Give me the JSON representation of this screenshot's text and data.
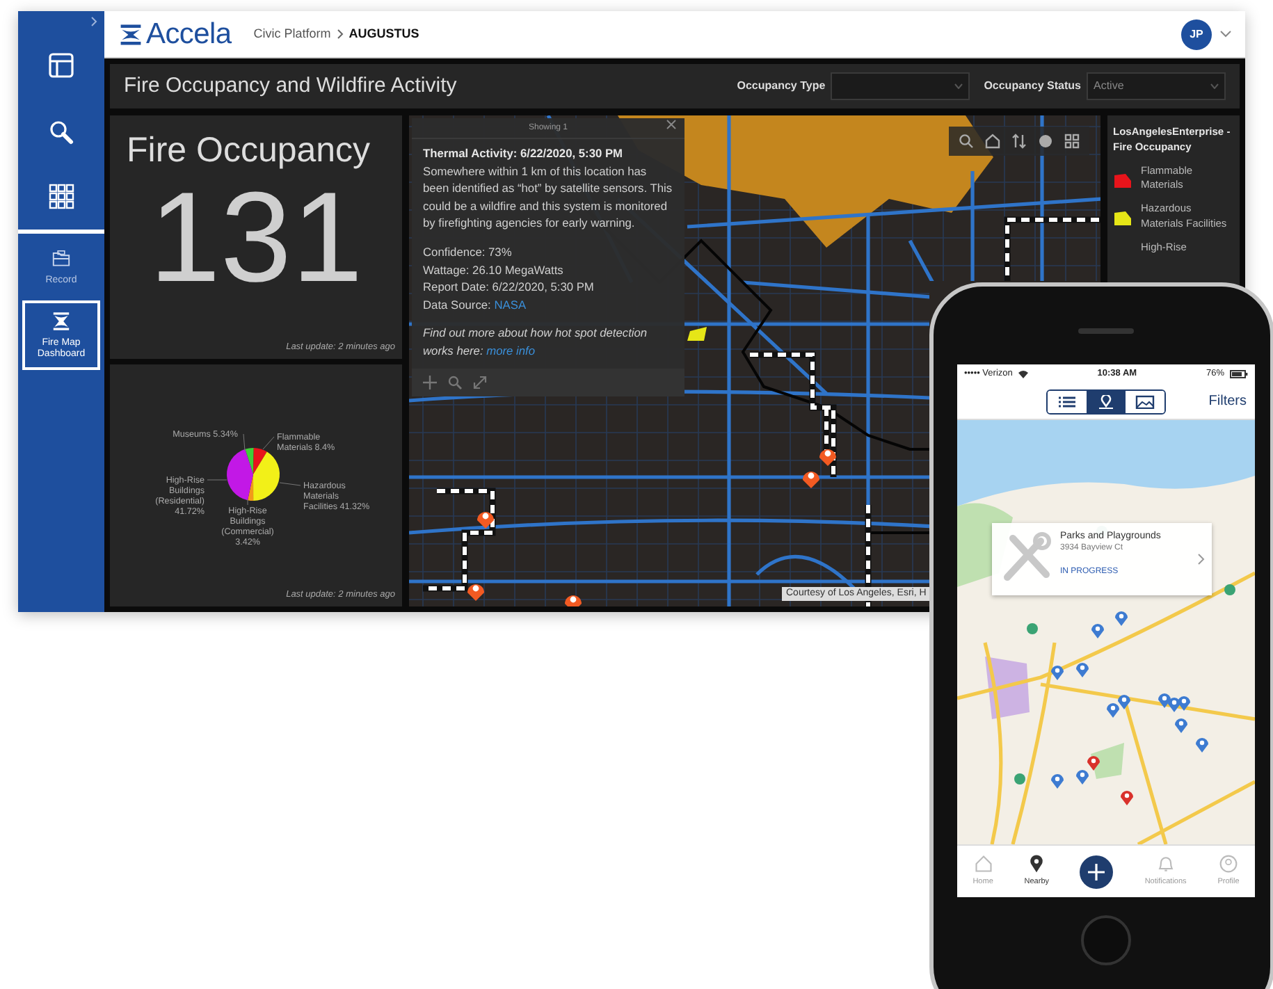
{
  "sidebar": {
    "items": [
      {
        "selected": false
      },
      {
        "selected": false
      },
      {
        "selected": false
      },
      {
        "label": "Record",
        "selected": false
      },
      {
        "label": "Fire Map Dashboard",
        "selected": true
      }
    ]
  },
  "header": {
    "logo": "Accela",
    "breadcrumb": [
      {
        "label": "Civic Platform",
        "current": false
      },
      {
        "label": "AUGUSTUS",
        "current": true
      }
    ],
    "user": {
      "initials": "JP"
    }
  },
  "dashboard": {
    "title": "Fire Occupancy and Wildfire Activity",
    "filters": [
      {
        "label": "Occupancy Type"
      },
      {
        "label": "Occupancy Status",
        "value": "Active"
      }
    ]
  },
  "stat_card": {
    "title": "Fire Occupancy",
    "value": "131",
    "footer": "Last update: 2 minutes ago"
  },
  "pie_card": {
    "chart_data": {
      "type": "pie",
      "categories": [
        "Museums",
        "Flammable Materials",
        "Hazardous Materials Facilities",
        "High-Rise Buildings (Commercial)",
        "High-Rise Buildings (Residential)"
      ],
      "values": [
        5.34,
        8.4,
        41.32,
        3.42,
        41.72
      ],
      "colors": [
        "#3fcf3a",
        "#e8141b",
        "#f2f018",
        "#f29a1a",
        "#c218e6"
      ],
      "value_labels": [
        "5.34%",
        "8.4%",
        "41.32%",
        "3.42%",
        "41.72%"
      ]
    },
    "footer": "Last update: 2 minutes ago"
  },
  "map": {
    "popup": {
      "header": "Showing 1",
      "title": "Thermal Activity: 6/22/2020, 5:30 PM",
      "description": "Somewhere within 1 km of this location has been identified as “hot” by satellite sensors. This could be a wildfire and this system is monitored by firefighting agencies for early warning.",
      "details": [
        "Confidence: 73%",
        "Wattage: 26.10 MegaWatts",
        "Report Date: 6/22/2020, 5:30 PM"
      ],
      "source_label": "Data Source:",
      "source_link": "NASA",
      "note": "Find out more about how hot spot detection works here:",
      "note_link": "more info"
    },
    "attribution": "Courtesy of Los Angeles, Esri, H"
  },
  "legend": {
    "title": "LosAngelesEnterprise - Fire Occupancy",
    "items": [
      {
        "label": "Flammable Materials",
        "color": "#e8141b"
      },
      {
        "label": "Hazardous Materials Facilities",
        "color": "#e6e617"
      },
      {
        "label": "High-Rise"
      }
    ]
  },
  "phone": {
    "carrier": "••••• Verizon",
    "time": "10:38 AM",
    "battery": "76%",
    "view_toggle": [
      {
        "selected": false
      },
      {
        "selected": true
      },
      {
        "selected": false
      }
    ],
    "filters": "Filters",
    "card": {
      "title": "Parks and Playgrounds",
      "address": "3934 Bayview Ct",
      "status": "IN PROGRESS"
    },
    "tabs": [
      {
        "label": "Home",
        "selected": false
      },
      {
        "label": "Nearby",
        "selected": true
      },
      {
        "label": "Notifications",
        "selected": false
      },
      {
        "label": "Profile",
        "selected": false
      }
    ]
  }
}
